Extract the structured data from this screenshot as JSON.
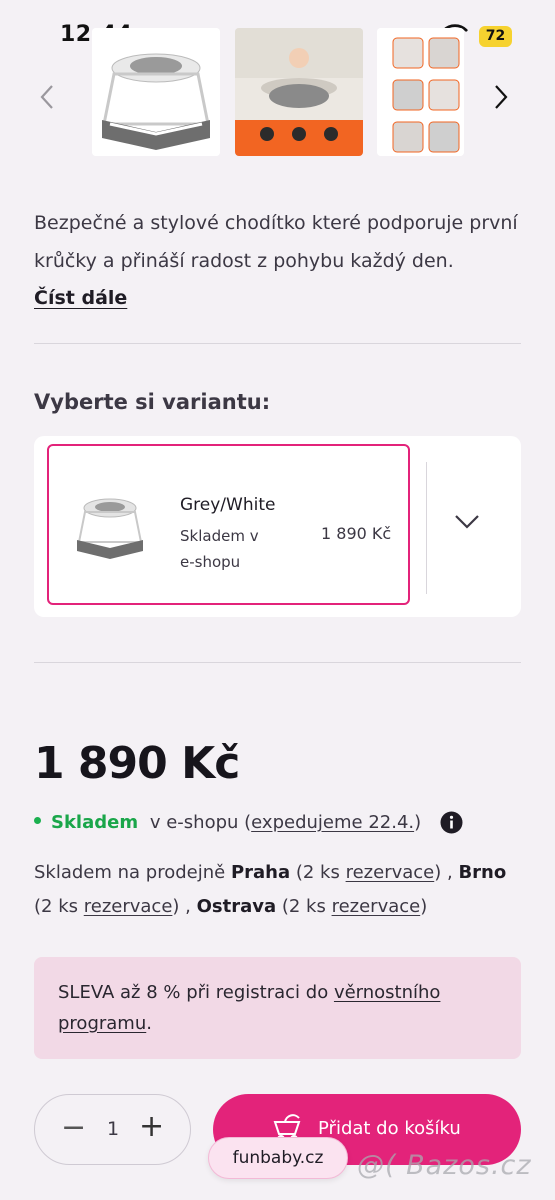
{
  "status_bar": {
    "time": "12:44",
    "battery": "72"
  },
  "gallery": {
    "prev_icon": "chevron-left-icon",
    "next_icon": "chevron-right-icon",
    "images": [
      "baby-walker-grey-white",
      "baby-walker-room-photo",
      "baby-walker-feature-details"
    ]
  },
  "description": {
    "text": "Bezpečné a stylové chodítko které podporuje první krůčky a přináší radost z pohybu každý den.",
    "read_more": "Číst dále"
  },
  "variant": {
    "heading": "Vyberte si variantu:",
    "name": "Grey/White",
    "stock": "Skladem v e-shopu",
    "price": "1 890 Kč"
  },
  "product": {
    "price": "1 890 Kč",
    "stock_status": "Skladem",
    "stock_eshop": "v e-shopu (",
    "ship_link": "expedujeme 22.4.",
    "ship_close": ")"
  },
  "stores": {
    "intro": "Skladem na prodejně ",
    "praha": "Praha",
    "praha_count": " (2 ks ",
    "reserve": "rezervace",
    "sep1": ") , ",
    "brno": "Brno",
    "brno_count": " (2 ks ",
    "sep2": ") , ",
    "ostrava": "Ostrava",
    "ostrava_count": " (2 ks ",
    "end": ")"
  },
  "promo": {
    "text": "SLEVA až 8 % při registraci do ",
    "link": "věrnostního programu",
    "end": "."
  },
  "cart": {
    "quantity": "1",
    "minus": "−",
    "plus": "+",
    "add_label": "Přidat do košíku"
  },
  "watermark": {
    "shop": "funbaby.cz",
    "site": "@( Bazos.cz"
  },
  "colors": {
    "accent": "#e3237a",
    "stock_green": "#1aa64a",
    "promo_bg": "#f2d9e6",
    "page_bg": "#f4f1f5"
  }
}
